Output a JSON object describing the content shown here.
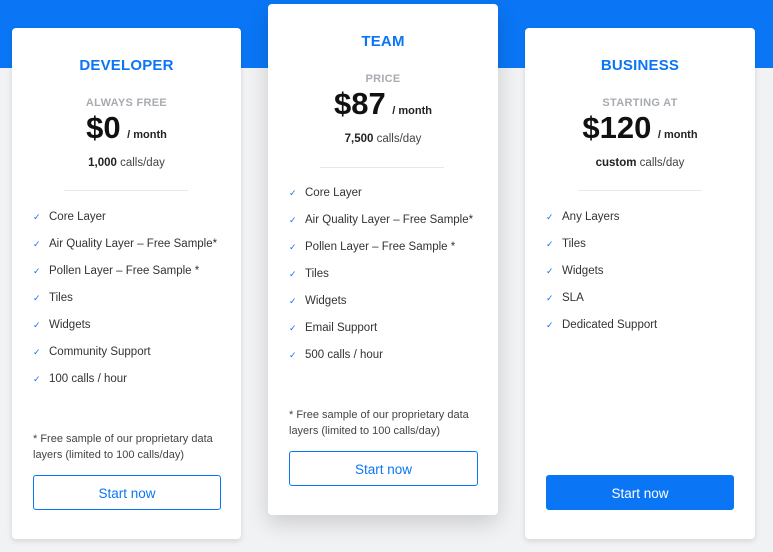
{
  "accent_color": "#0a76f5",
  "plans": {
    "developer": {
      "name": "DEVELOPER",
      "price_label": "ALWAYS FREE",
      "price": "$0",
      "per": "/ month",
      "calls_bold": "1,000",
      "calls_rest": "calls/day",
      "features": [
        "Core Layer",
        "Air Quality Layer – Free Sample*",
        "Pollen Layer – Free Sample *",
        "Tiles",
        "Widgets",
        "Community Support",
        "100 calls / hour"
      ],
      "footnote": "* Free sample of our proprietary data layers (limited to 100 calls/day)",
      "button": "Start now"
    },
    "team": {
      "name": "TEAM",
      "price_label": "PRICE",
      "price": "$87",
      "per": "/ month",
      "calls_bold": "7,500",
      "calls_rest": "calls/day",
      "features": [
        "Core Layer",
        "Air Quality Layer – Free Sample*",
        "Pollen Layer – Free Sample *",
        "Tiles",
        "Widgets",
        "Email Support",
        "500 calls / hour"
      ],
      "footnote": "* Free sample of our proprietary data layers (limited to 100 calls/day)",
      "button": "Start now"
    },
    "business": {
      "name": "BUSINESS",
      "price_label": "STARTING AT",
      "price": "$120",
      "per": "/ month",
      "calls_bold": "custom",
      "calls_rest": "calls/day",
      "features": [
        "Any Layers",
        "Tiles",
        "Widgets",
        "SLA",
        "Dedicated Support"
      ],
      "button": "Start now"
    }
  }
}
